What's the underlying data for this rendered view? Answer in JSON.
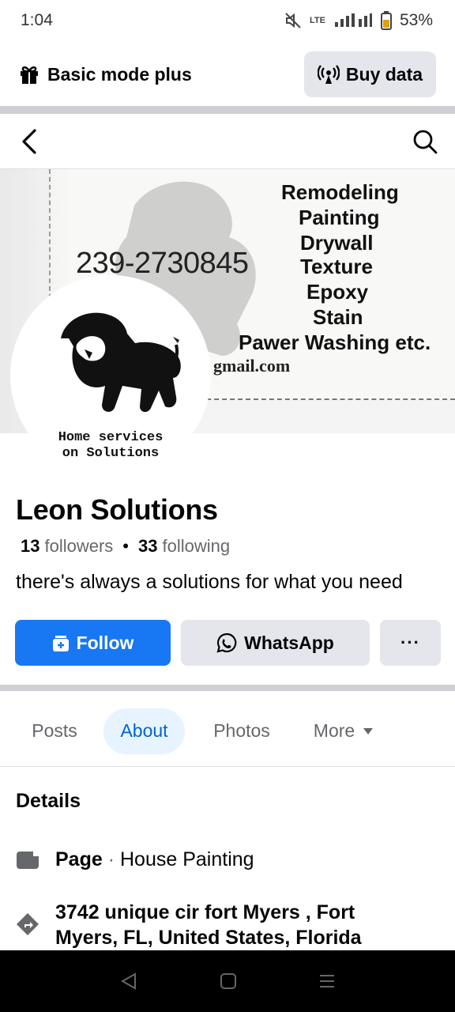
{
  "status_bar": {
    "time": "1:04",
    "network_label": "LTE",
    "battery": "53%"
  },
  "top_bar": {
    "mode_label": "Basic mode plus",
    "buy_data_label": "Buy data"
  },
  "cover": {
    "phone": "239-2730845",
    "services": [
      "Remodeling",
      "Painting",
      "Drywall",
      "Texture",
      "Epoxy",
      "Stain",
      "Pawer Washing etc."
    ],
    "email_fragment": "gmail.com"
  },
  "avatar": {
    "caption_line1": "Home services",
    "caption_line2": "on Solutions"
  },
  "profile": {
    "name": "Leon Solutions",
    "followers_count": "13",
    "followers_label": "followers",
    "following_count": "33",
    "following_label": "following",
    "bio": "there's always a solutions for what you need"
  },
  "actions": {
    "follow_label": "Follow",
    "whatsapp_label": "WhatsApp",
    "more_label": "···"
  },
  "tabs": [
    {
      "label": "Posts",
      "active": false
    },
    {
      "label": "About",
      "active": true
    },
    {
      "label": "Photos",
      "active": false
    },
    {
      "label": "More",
      "active": false
    }
  ],
  "details": {
    "title": "Details",
    "page_label": "Page",
    "page_separator": "·",
    "page_category": "House Painting",
    "address_line1": "3742 unique cir fort Myers , Fort",
    "address_line2": "Myers, FL, United States, Florida"
  },
  "colors": {
    "primary": "#1877f2",
    "active_tab_bg": "#e7f3ff",
    "active_tab_text": "#0064d1",
    "button_gray": "#e4e6eb"
  }
}
